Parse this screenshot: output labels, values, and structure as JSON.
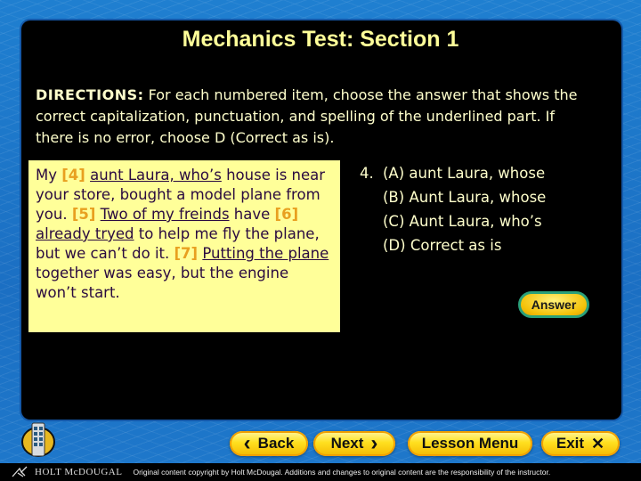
{
  "title": "Mechanics Test: Section 1",
  "directions": {
    "label": "DIRECTIONS:",
    "text": " For each numbered item, choose the answer that shows the correct capitalization, punctuation, and spelling of the underlined part. If there is no error, choose D (Correct as is)."
  },
  "passage": {
    "segments": [
      {
        "type": "text",
        "value": " My "
      },
      {
        "type": "num",
        "value": "[4]"
      },
      {
        "type": "text",
        "value": " "
      },
      {
        "type": "ul",
        "value": "aunt Laura, who’s"
      },
      {
        "type": "text",
        "value": " house is near your store, bought a model plane from you. "
      },
      {
        "type": "num",
        "value": "[5]"
      },
      {
        "type": "text",
        "value": " "
      },
      {
        "type": "ul",
        "value": "Two of my freinds"
      },
      {
        "type": "text",
        "value": " have "
      },
      {
        "type": "num",
        "value": "[6]"
      },
      {
        "type": "text",
        "value": " "
      },
      {
        "type": "ul",
        "value": "already tryed"
      },
      {
        "type": "text",
        "value": " to help me fly the plane, but we can’t do it. "
      },
      {
        "type": "num",
        "value": "[7]"
      },
      {
        "type": "text",
        "value": " "
      },
      {
        "type": "ul",
        "value": "Putting the plane"
      },
      {
        "type": "text",
        "value": " together was easy, but the engine won’t start."
      }
    ]
  },
  "question": {
    "number": "4.",
    "options": [
      {
        "letter": "(A)",
        "text": "aunt Laura, whose"
      },
      {
        "letter": "(B)",
        "text": "Aunt Laura, whose"
      },
      {
        "letter": "(C)",
        "text": "Aunt Laura, who’s"
      },
      {
        "letter": "(D)",
        "text": "Correct as is"
      }
    ]
  },
  "answer_button": "Answer",
  "nav": {
    "back": {
      "label": "Back",
      "icon": "‹"
    },
    "next": {
      "label": "Next",
      "icon": "›"
    },
    "lesson_menu": {
      "label": "Lesson Menu"
    },
    "exit": {
      "label": "Exit",
      "icon": "✕"
    }
  },
  "footer": {
    "brand": "HOLT McDOUGAL",
    "copyright": "Original content copyright by Holt McDougal. Additions and changes to original content are the responsibility of the instructor."
  },
  "colors": {
    "title": "#ffff99",
    "passage_bg": "#ffff99",
    "bracket_num": "#e8a020",
    "button_yellow": "#ffe020",
    "background_blue": "#1b6fc3"
  }
}
